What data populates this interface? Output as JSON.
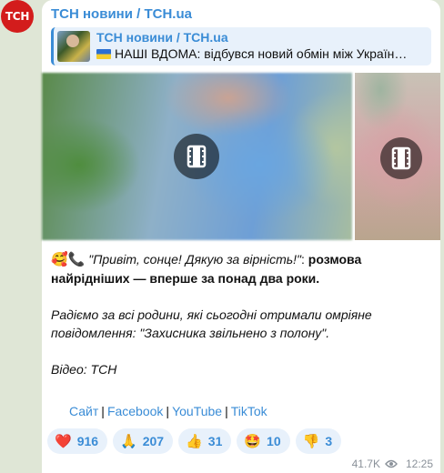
{
  "avatar": {
    "text": "ТСН"
  },
  "channel": {
    "name": "ТСН новини / TCH.ua"
  },
  "forward": {
    "title": "ТСН новини / TCH.ua",
    "text": "НАШІ ВДОМА: відбувся новий обмін між Україн…"
  },
  "message": {
    "quote": "\"Привіт, сонце! Дякую за вірність!\"",
    "colon": ":",
    "bold": "розмова найрідніших — вперше за понад два роки.",
    "p2": "Радіємо за всі родини, які сьогодні отримали омріяне повідомлення: \"Захисника звільнено з полону\".",
    "p3": "Відео: ТСН"
  },
  "links": [
    {
      "label": "Сайт"
    },
    {
      "label": "Facebook"
    },
    {
      "label": "YouTube"
    },
    {
      "label": "TikTok"
    }
  ],
  "reactions": [
    {
      "icon": "❤️",
      "icon_name": "heart-icon",
      "count": "916"
    },
    {
      "icon": "🙏",
      "icon_name": "pray-icon",
      "count": "207"
    },
    {
      "icon": "👍",
      "icon_name": "thumbs-up-icon",
      "count": "31"
    },
    {
      "icon": "🤩",
      "icon_name": "star-struck-icon",
      "count": "10"
    },
    {
      "icon": "👎",
      "icon_name": "thumbs-down-icon",
      "count": "3"
    }
  ],
  "meta": {
    "views": "41.7K",
    "time": "12:25"
  },
  "colors": {
    "accent": "#3a8cd6",
    "avatar_bg": "#d31c1c"
  }
}
